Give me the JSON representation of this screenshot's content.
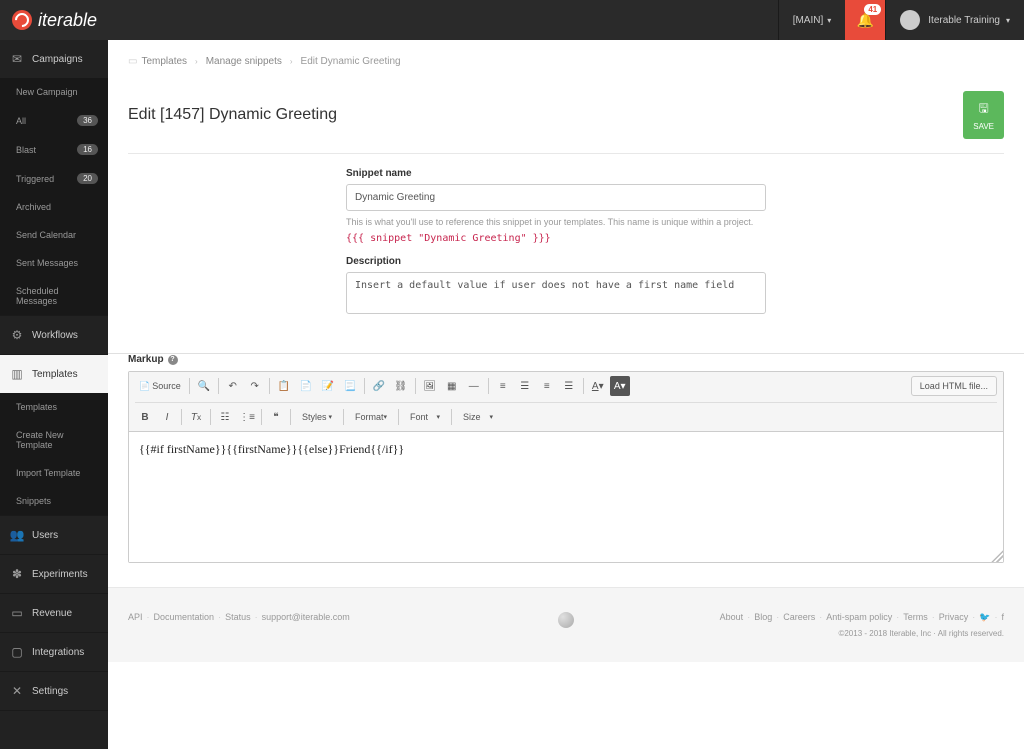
{
  "brand": "iterable",
  "topbar": {
    "org": "[MAIN]",
    "notifications": 41,
    "user": "Iterable Training"
  },
  "sidebar": [
    {
      "label": "Campaigns",
      "icon": "✉",
      "children": [
        {
          "label": "New Campaign"
        },
        {
          "label": "All",
          "badge": "36"
        },
        {
          "label": "Blast",
          "badge": "16"
        },
        {
          "label": "Triggered",
          "badge": "20"
        },
        {
          "label": "Archived"
        },
        {
          "label": "Send Calendar"
        },
        {
          "label": "Sent Messages"
        },
        {
          "label": "Scheduled Messages"
        }
      ]
    },
    {
      "label": "Workflows",
      "icon": "⚙"
    },
    {
      "label": "Templates",
      "icon": "▥",
      "active": true,
      "children": [
        {
          "label": "Templates"
        },
        {
          "label": "Create New Template"
        },
        {
          "label": "Import Template"
        },
        {
          "label": "Snippets"
        }
      ]
    },
    {
      "label": "Users",
      "icon": "👥"
    },
    {
      "label": "Experiments",
      "icon": "✽"
    },
    {
      "label": "Revenue",
      "icon": "▭"
    },
    {
      "label": "Integrations",
      "icon": "▢"
    },
    {
      "label": "Settings",
      "icon": "✕"
    }
  ],
  "breadcrumb": [
    "Templates",
    "Manage snippets",
    "Edit Dynamic Greeting"
  ],
  "page_title": "Edit [1457] Dynamic Greeting",
  "save_label": "SAVE",
  "form": {
    "name_label": "Snippet name",
    "name_value": "Dynamic Greeting",
    "name_help": "This is what you'll use to reference this snippet in your templates. This name is unique within a project.",
    "code_ref": "{{{ snippet \"Dynamic Greeting\" }}}",
    "desc_label": "Description",
    "desc_value": "Insert a default value if user does not have a first name field"
  },
  "markup": {
    "label": "Markup",
    "load_btn": "Load HTML file...",
    "source_label": "Source",
    "dd_styles": "Styles",
    "dd_format": "Format",
    "dd_font": "Font",
    "dd_size": "Size",
    "content": "{{#if firstName}}{{firstName}}{{else}}Friend{{/if}}"
  },
  "footer": {
    "left": [
      "API",
      "Documentation",
      "Status",
      "support@iterable.com"
    ],
    "right": [
      "About",
      "Blog",
      "Careers",
      "Anti-spam policy",
      "Terms",
      "Privacy"
    ],
    "copyright": "©2013 - 2018 Iterable, Inc · All rights reserved."
  }
}
